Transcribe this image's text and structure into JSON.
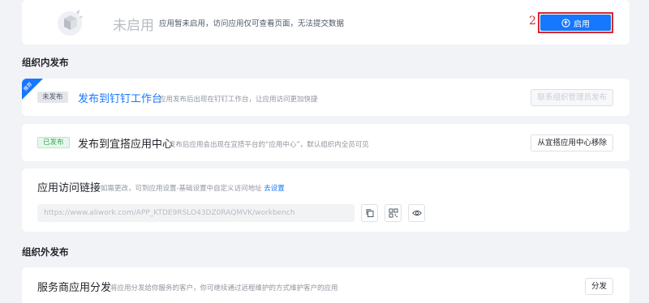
{
  "status": {
    "label": "未启用",
    "description": "应用暂未启用，访问应用仅可查看页面，无法提交数据",
    "annotation": "2",
    "enable_button": "启用"
  },
  "internal_section": {
    "title": "组织内发布",
    "rows": [
      {
        "ribbon": "推荐",
        "badge": "未发布",
        "title": "发布到钉钉工作台",
        "description": "应用发布后出现在钉钉工作台，让应用访问更加快捷",
        "button": "联系组织管理员发布"
      },
      {
        "badge": "已发布",
        "title": "发布到宜搭应用中心",
        "description": "发布后应用会出现在宜搭平台的“应用中心”，默认组织内全员可见",
        "button": "从宜搭应用中心移除"
      }
    ]
  },
  "access_link": {
    "title": "应用访问链接",
    "description": "如需更改，可到应用设置-基础设置中自定义访问地址",
    "settings_link": "去设置",
    "url": "https://www.aliwork.com/APP_KTDE9RSLO43DZ0RAQMVK/workbench",
    "actions": [
      "copy-icon",
      "qrcode-icon",
      "eye-icon"
    ]
  },
  "external_section": {
    "title": "组织外发布",
    "rows": [
      {
        "title": "服务商应用分发",
        "description": "将应用分发给你服务的客户，你可继续通过远程维护的方式维护客户的应用",
        "button": "分发"
      }
    ]
  },
  "colors": {
    "primary": "#1677ff",
    "annotation": "#d8262c",
    "background": "#f2f3f7"
  }
}
